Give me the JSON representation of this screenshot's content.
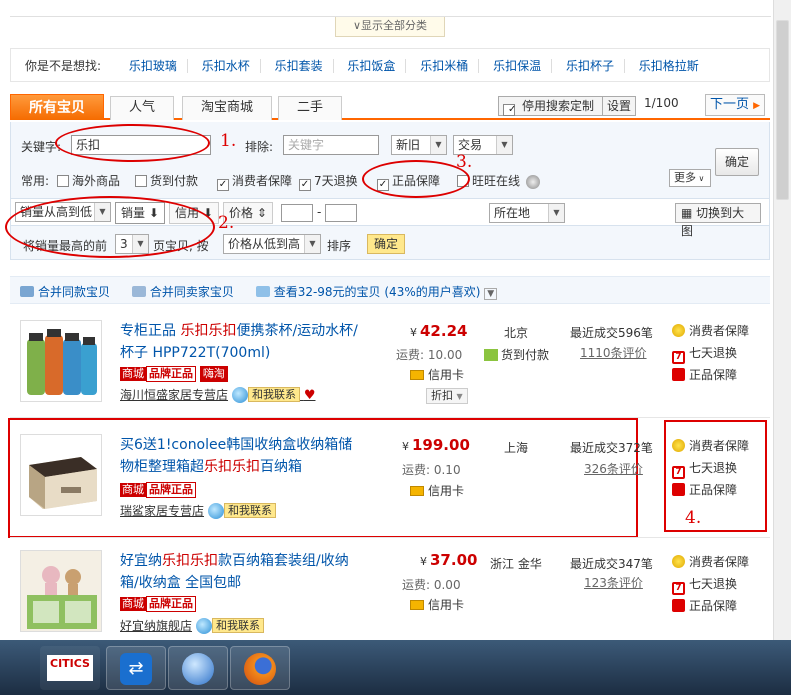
{
  "top": {
    "show_all_label": "∨显示全部分类"
  },
  "suggest": {
    "label": "你是不是想找:",
    "items": [
      "乐扣玻璃",
      "乐扣水杯",
      "乐扣套装",
      "乐扣饭盒",
      "乐扣米桶",
      "乐扣保温",
      "乐扣杯子",
      "乐扣格拉斯"
    ]
  },
  "tabs": [
    "所有宝贝",
    "人气",
    "淘宝商城",
    "二手"
  ],
  "custom": {
    "disable_label": "停用搜索定制",
    "settings_label": "设置"
  },
  "pager": {
    "current": "1/100",
    "next_label": "下一页"
  },
  "filter": {
    "keyword_label": "关键字:",
    "keyword_value": "乐扣",
    "exclude_label": "排除:",
    "exclude_placeholder": "关键字",
    "condition_value": "新旧",
    "trade_value": "交易",
    "confirm_label": "确定",
    "common_label": "常用:",
    "checks": [
      {
        "label": "海外商品",
        "checked": false
      },
      {
        "label": "货到付款",
        "checked": false
      },
      {
        "label": "消费者保障",
        "checked": true
      },
      {
        "label": "7天退换",
        "checked": true
      },
      {
        "label": "正品保障",
        "checked": true
      },
      {
        "label": "旺旺在线",
        "checked": false
      }
    ],
    "more_label": "更多",
    "sort_select": "销量从高到低",
    "sort_sales": "销量",
    "sort_credit": "信用",
    "sort_price": "价格",
    "price_sep": "-",
    "location_label": "所在地",
    "big_view_label": "切换到大图",
    "top_n_prefix": "将销量最高的前",
    "top_n_value": "3",
    "top_n_mid": "页宝贝, 按",
    "top_n_sort": "价格从低到高",
    "top_n_suffix": "排序",
    "top_n_confirm": "确定"
  },
  "annotations": [
    "1.",
    "2.",
    "3.",
    "4."
  ],
  "merge": {
    "items": [
      "合并同款宝贝",
      "合并同卖家宝贝",
      "查看32-98元的宝贝 (43%的用户喜欢)"
    ]
  },
  "products": [
    {
      "title_pre": "专柜正品 ",
      "title_hl": "乐扣乐扣",
      "title_post": "便携茶杯/运动水杯/杯子 HPP722T(700ml)",
      "badges": [
        "商城",
        "品牌正品",
        "嗨淘"
      ],
      "shop": "海川恒盛家居专营店",
      "contact": "和我联系",
      "currency": "¥",
      "price": "42.24",
      "freight": "运费: 10.00",
      "payment": "信用卡",
      "discount": "折扣",
      "location": "北京",
      "cod": "货到付款",
      "sales": "最近成交596笔",
      "reviews": "1110条评价",
      "guarantees": [
        "消费者保障",
        "七天退换",
        "正品保障"
      ]
    },
    {
      "title_pre": "买6送1!conolee韩国收纳盒收纳箱储物柜整理箱超",
      "title_hl": "乐扣乐扣",
      "title_post": "百纳箱",
      "badges": [
        "商城",
        "品牌正品"
      ],
      "shop": "瑞鲨家居专营店",
      "contact": "和我联系",
      "currency": "¥",
      "price": "199.00",
      "freight": "运费: 0.10",
      "payment": "信用卡",
      "location": "上海",
      "sales": "最近成交372笔",
      "reviews": "326条评价",
      "guarantees": [
        "消费者保障",
        "七天退换",
        "正品保障"
      ]
    },
    {
      "title_pre": "好宜纳",
      "title_hl": "乐扣乐扣",
      "title_post": "款百纳箱套装组/收纳箱/收纳盒 全国包邮",
      "badges": [
        "商城",
        "品牌正品"
      ],
      "shop": "好宜纳旗舰店",
      "contact": "和我联系",
      "currency": "¥",
      "price": "37.00",
      "freight": "运费: 0.00",
      "payment": "信用卡",
      "location": "浙江 金华",
      "sales": "最近成交347笔",
      "reviews": "123条评价",
      "guarantees": [
        "消费者保障",
        "七天退换",
        "正品保障"
      ]
    }
  ],
  "colors": {
    "accent": "#ff6600",
    "link": "#0055aa",
    "price": "#cc0000",
    "annotation": "#dd0000"
  },
  "taskbar": {
    "apps": [
      "citics-icon",
      "teamviewer-icon",
      "messenger-icon",
      "firefox-icon"
    ],
    "citics_label": "CITICS"
  }
}
